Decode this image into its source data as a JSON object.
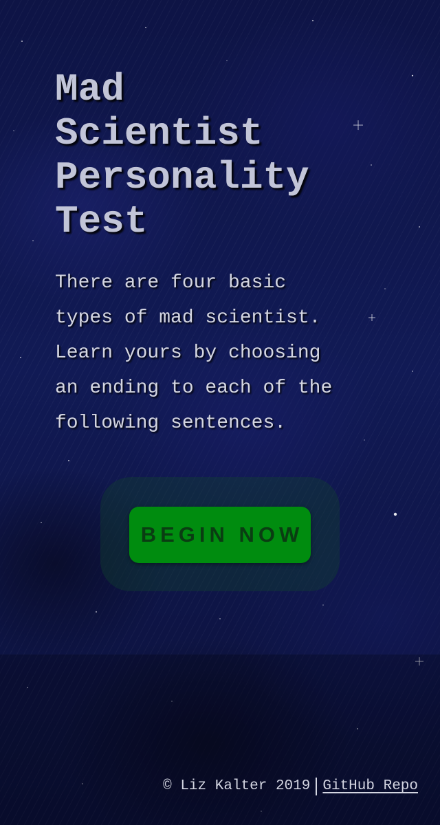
{
  "hero": {
    "title_lines": [
      "Mad",
      "Scientist",
      "Personality",
      "Test"
    ],
    "intro_lines": [
      "There are four basic",
      "types of mad scientist.",
      "Learn yours by choosing",
      "an ending to each of the",
      "following sentences."
    ],
    "begin_button_label": "BEGIN NOW"
  },
  "footer": {
    "copyright": "© Liz Kalter 2019",
    "repo_link_label": "GitHub Repo"
  },
  "colors": {
    "background": "#0e1445",
    "title_text": "#c2c5d8",
    "body_text": "#d4d6e2",
    "button_bg": "#008c0f",
    "button_text": "#0a3d12"
  }
}
